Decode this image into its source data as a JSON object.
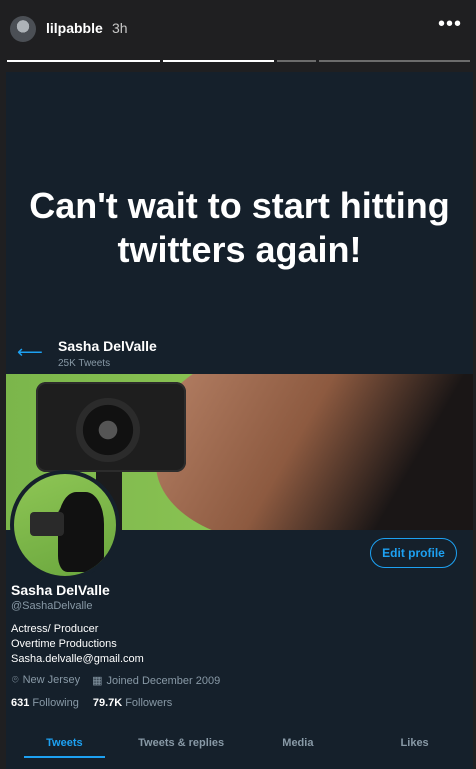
{
  "story": {
    "username": "lilpabble",
    "time_ago": "3h",
    "more_icon": "more-dots-icon",
    "progress": [
      1,
      1,
      0,
      0
    ],
    "text": "Can't wait to start hitting twitters again!"
  },
  "twitter": {
    "name": "Sasha DelValle",
    "tweet_count": "25K Tweets",
    "handle": "@SashaDelvalle",
    "bio_lines": [
      "Actress/ Producer",
      "Overtime Productions",
      "Sasha.delvalle@gmail.com"
    ],
    "location": "New Jersey",
    "joined": "Joined December 2009",
    "following_count": "631",
    "following_label": "Following",
    "followers_count": "79.7K",
    "followers_label": "Followers",
    "edit_profile_label": "Edit profile",
    "tabs": [
      "Tweets",
      "Tweets & replies",
      "Media",
      "Likes"
    ],
    "active_tab": "Tweets",
    "accent_color": "#1da1f2"
  }
}
